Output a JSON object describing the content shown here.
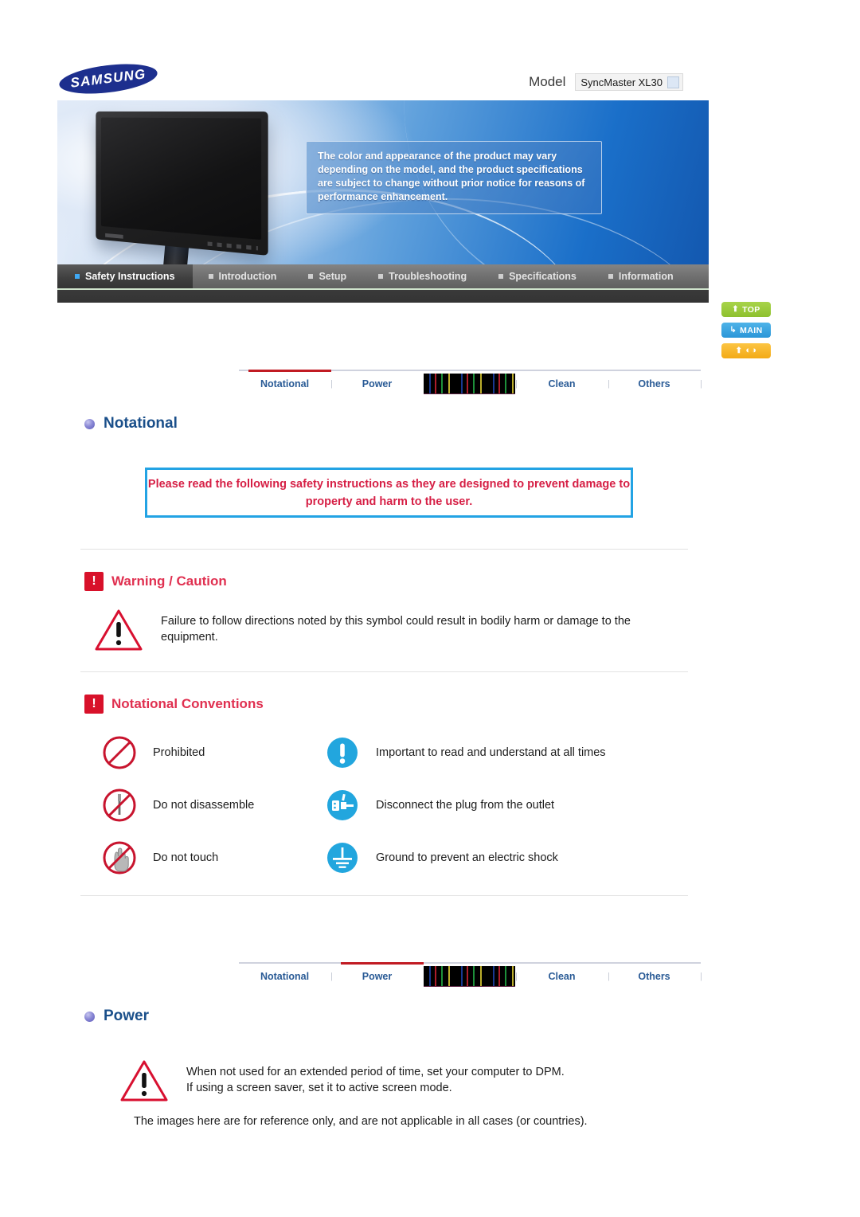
{
  "header": {
    "brand": "SAMSUNG",
    "model_label": "Model",
    "model_value": "SyncMaster XL30"
  },
  "hero": {
    "note": "The color and appearance of the product may vary depending on the model, and the product specifications are subject to change without prior notice for reasons of performance enhancement."
  },
  "main_nav": {
    "items": [
      {
        "label": "Safety Instructions",
        "active": true
      },
      {
        "label": "Introduction",
        "active": false
      },
      {
        "label": "Setup",
        "active": false
      },
      {
        "label": "Troubleshooting",
        "active": false
      },
      {
        "label": "Specifications",
        "active": false
      },
      {
        "label": "Information",
        "active": false
      }
    ]
  },
  "side_buttons": [
    {
      "label": "TOP",
      "icon": "up-arrow-icon",
      "color": "#8ec02e"
    },
    {
      "label": "MAIN",
      "icon": "main-arrow-icon",
      "color": "#2a96d8"
    },
    {
      "label": "",
      "icon": "up-arrow-book-icon",
      "color": "#f3aa16"
    }
  ],
  "subnav_top": {
    "items": [
      {
        "label": "Notational",
        "active": true,
        "obscured": false
      },
      {
        "label": "Power",
        "active": false,
        "obscured": false
      },
      {
        "label": "",
        "active": false,
        "obscured": true
      },
      {
        "label": "Clean",
        "active": false,
        "obscured": false
      },
      {
        "label": "Others",
        "active": false,
        "obscured": false
      }
    ]
  },
  "subnav_bottom": {
    "items": [
      {
        "label": "Notational",
        "active": false,
        "obscured": false
      },
      {
        "label": "Power",
        "active": true,
        "obscured": false
      },
      {
        "label": "",
        "active": false,
        "obscured": true
      },
      {
        "label": "Clean",
        "active": false,
        "obscured": false
      },
      {
        "label": "Others",
        "active": false,
        "obscured": false
      }
    ]
  },
  "notational_section": {
    "title": "Notational",
    "callout": "Please read the following safety instructions as they are designed to prevent damage to property and harm to the user.",
    "warning_heading": "Warning / Caution",
    "warning_text": "Failure to follow directions noted by this symbol could result in bodily harm or damage to the equipment.",
    "conventions_heading": "Notational Conventions",
    "conventions": [
      {
        "icon": "prohibited-icon",
        "label": "Prohibited"
      },
      {
        "icon": "important-exclamation-icon",
        "label": "Important to read and understand at all times"
      },
      {
        "icon": "do-not-disassemble-icon",
        "label": "Do not disassemble"
      },
      {
        "icon": "disconnect-plug-icon",
        "label": "Disconnect the plug from the outlet"
      },
      {
        "icon": "do-not-touch-icon",
        "label": "Do not touch"
      },
      {
        "icon": "ground-icon",
        "label": "Ground to prevent an electric shock"
      }
    ]
  },
  "power_section": {
    "title": "Power",
    "warning_text": "When not used for an extended period of time, set your computer to DPM.\nIf using a screen saver, set it to active screen mode.",
    "footnote": "The images here are for reference only, and are not applicable in all cases (or countries)."
  }
}
